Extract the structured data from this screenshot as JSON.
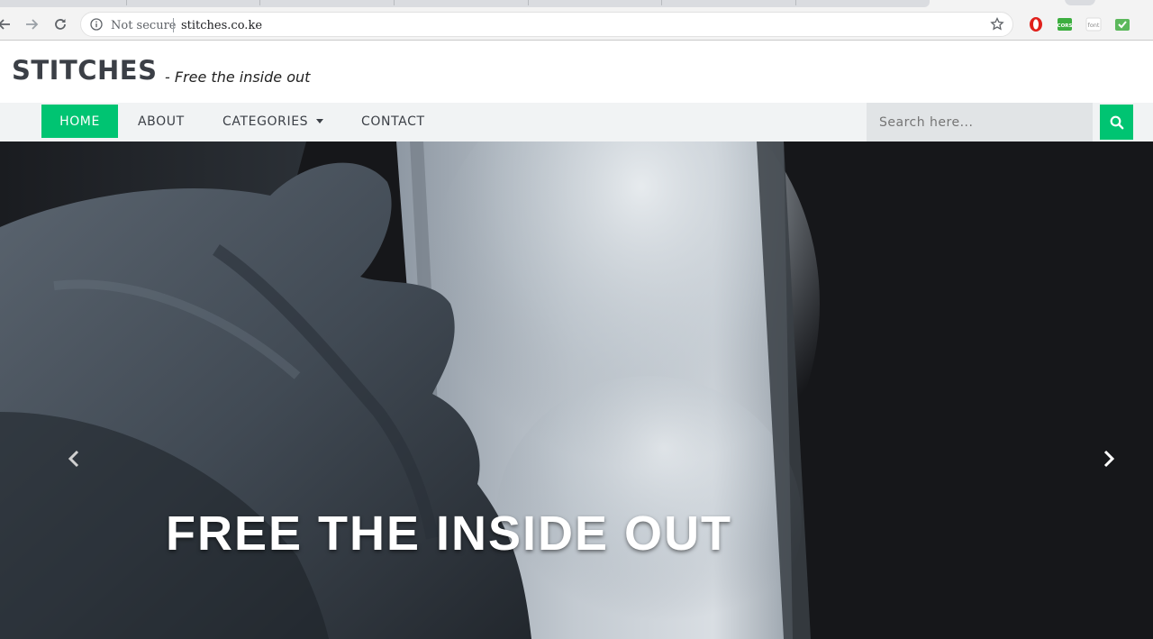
{
  "browser": {
    "security_label": "Not secure",
    "url": "stitches.co.ke",
    "extensions": [
      {
        "name": "opera-icon",
        "color": "#e0201b"
      },
      {
        "name": "cors-icon",
        "label": "CORS",
        "color": "#3cae3f"
      },
      {
        "name": "font-icon",
        "label": "font",
        "color": "#9e9e9e"
      },
      {
        "name": "check-icon",
        "color": "#5cb85c"
      }
    ]
  },
  "site": {
    "brand": "STITCHES",
    "tagline": "- Free the inside out"
  },
  "nav": {
    "items": [
      {
        "label": "HOME",
        "active": true
      },
      {
        "label": "ABOUT"
      },
      {
        "label": "CATEGORIES",
        "has_dropdown": true
      },
      {
        "label": "CONTACT"
      }
    ],
    "search_placeholder": "Search here..."
  },
  "hero": {
    "caption": "FREE THE INSIDE OUT"
  },
  "colors": {
    "accent": "#00c472",
    "nav_bg": "#f1f3f4",
    "hero_bg": "#16171a"
  }
}
